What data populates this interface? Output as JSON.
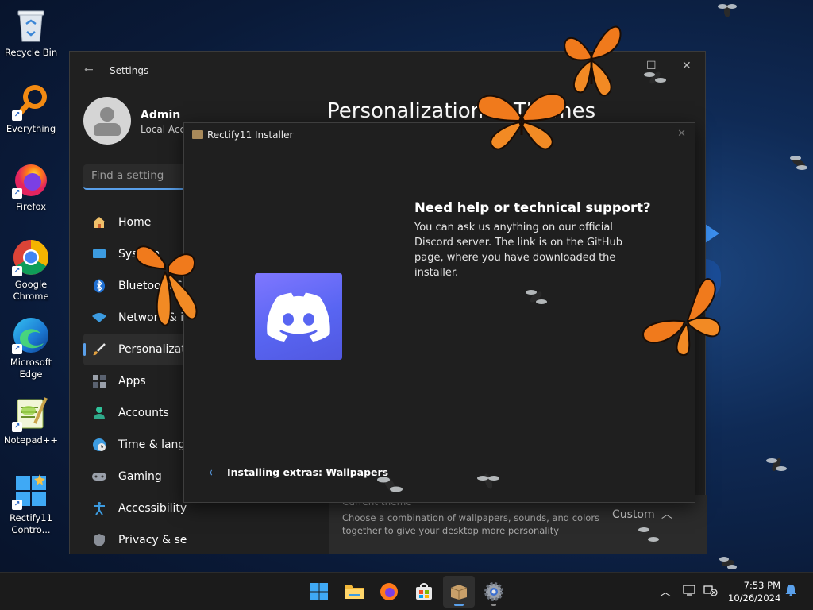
{
  "desktop": {
    "icons": [
      {
        "label": "Recycle Bin",
        "icon": "recycle-bin-icon"
      },
      {
        "label": "Everything",
        "icon": "everything-search-icon"
      },
      {
        "label": "Firefox",
        "icon": "firefox-icon"
      },
      {
        "label": "Google Chrome",
        "icon": "chrome-icon"
      },
      {
        "label": "Microsoft Edge",
        "icon": "edge-icon"
      },
      {
        "label": "Notepad++",
        "icon": "notepadpp-icon"
      },
      {
        "label": "Rectify11 Contro...",
        "icon": "rectify11-control-icon"
      }
    ]
  },
  "settings": {
    "title": "Settings",
    "user_name": "Admin",
    "user_sub": "Local Acco",
    "search_placeholder": "Find a setting",
    "page_title": "Personalization",
    "page_sep": ">",
    "page_sub": "Themes",
    "nav": [
      {
        "label": "Home",
        "icon": "home-icon"
      },
      {
        "label": "System",
        "icon": "system-icon"
      },
      {
        "label": "Bluetooth & devices",
        "icon": "bluetooth-icon"
      },
      {
        "label": "Network & internet",
        "icon": "wifi-icon"
      },
      {
        "label": "Personalization",
        "icon": "brush-icon"
      },
      {
        "label": "Apps",
        "icon": "apps-icon"
      },
      {
        "label": "Accounts",
        "icon": "accounts-icon"
      },
      {
        "label": "Time & language",
        "icon": "globe-clock-icon"
      },
      {
        "label": "Gaming",
        "icon": "gamepad-icon"
      },
      {
        "label": "Accessibility",
        "icon": "accessibility-icon"
      },
      {
        "label": "Privacy & security",
        "icon": "shield-icon"
      }
    ],
    "active_nav": "Personalization",
    "current_theme": {
      "title": "Current theme",
      "description": "Choose a combination of wallpapers, sounds, and colors together to give your desktop more personality",
      "value": "Custom"
    }
  },
  "installer": {
    "title": "Rectify11 Installer",
    "help_title": "Need help or technical support?",
    "help_body": "You can ask us anything on our official Discord server. The link is on the GitHub page, where you have downloaded the installer.",
    "status": "Installing extras: Wallpapers"
  },
  "taskbar": {
    "apps": [
      "start-icon",
      "file-explorer-icon",
      "firefox-icon",
      "store-icon",
      "installer-icon",
      "settings-gear-icon"
    ],
    "time": "7:53 PM",
    "date": "10/26/2024"
  },
  "colors": {
    "accent": "#5aa0ea",
    "discord": "#5865f2",
    "butterfly": "#f07a1c"
  }
}
